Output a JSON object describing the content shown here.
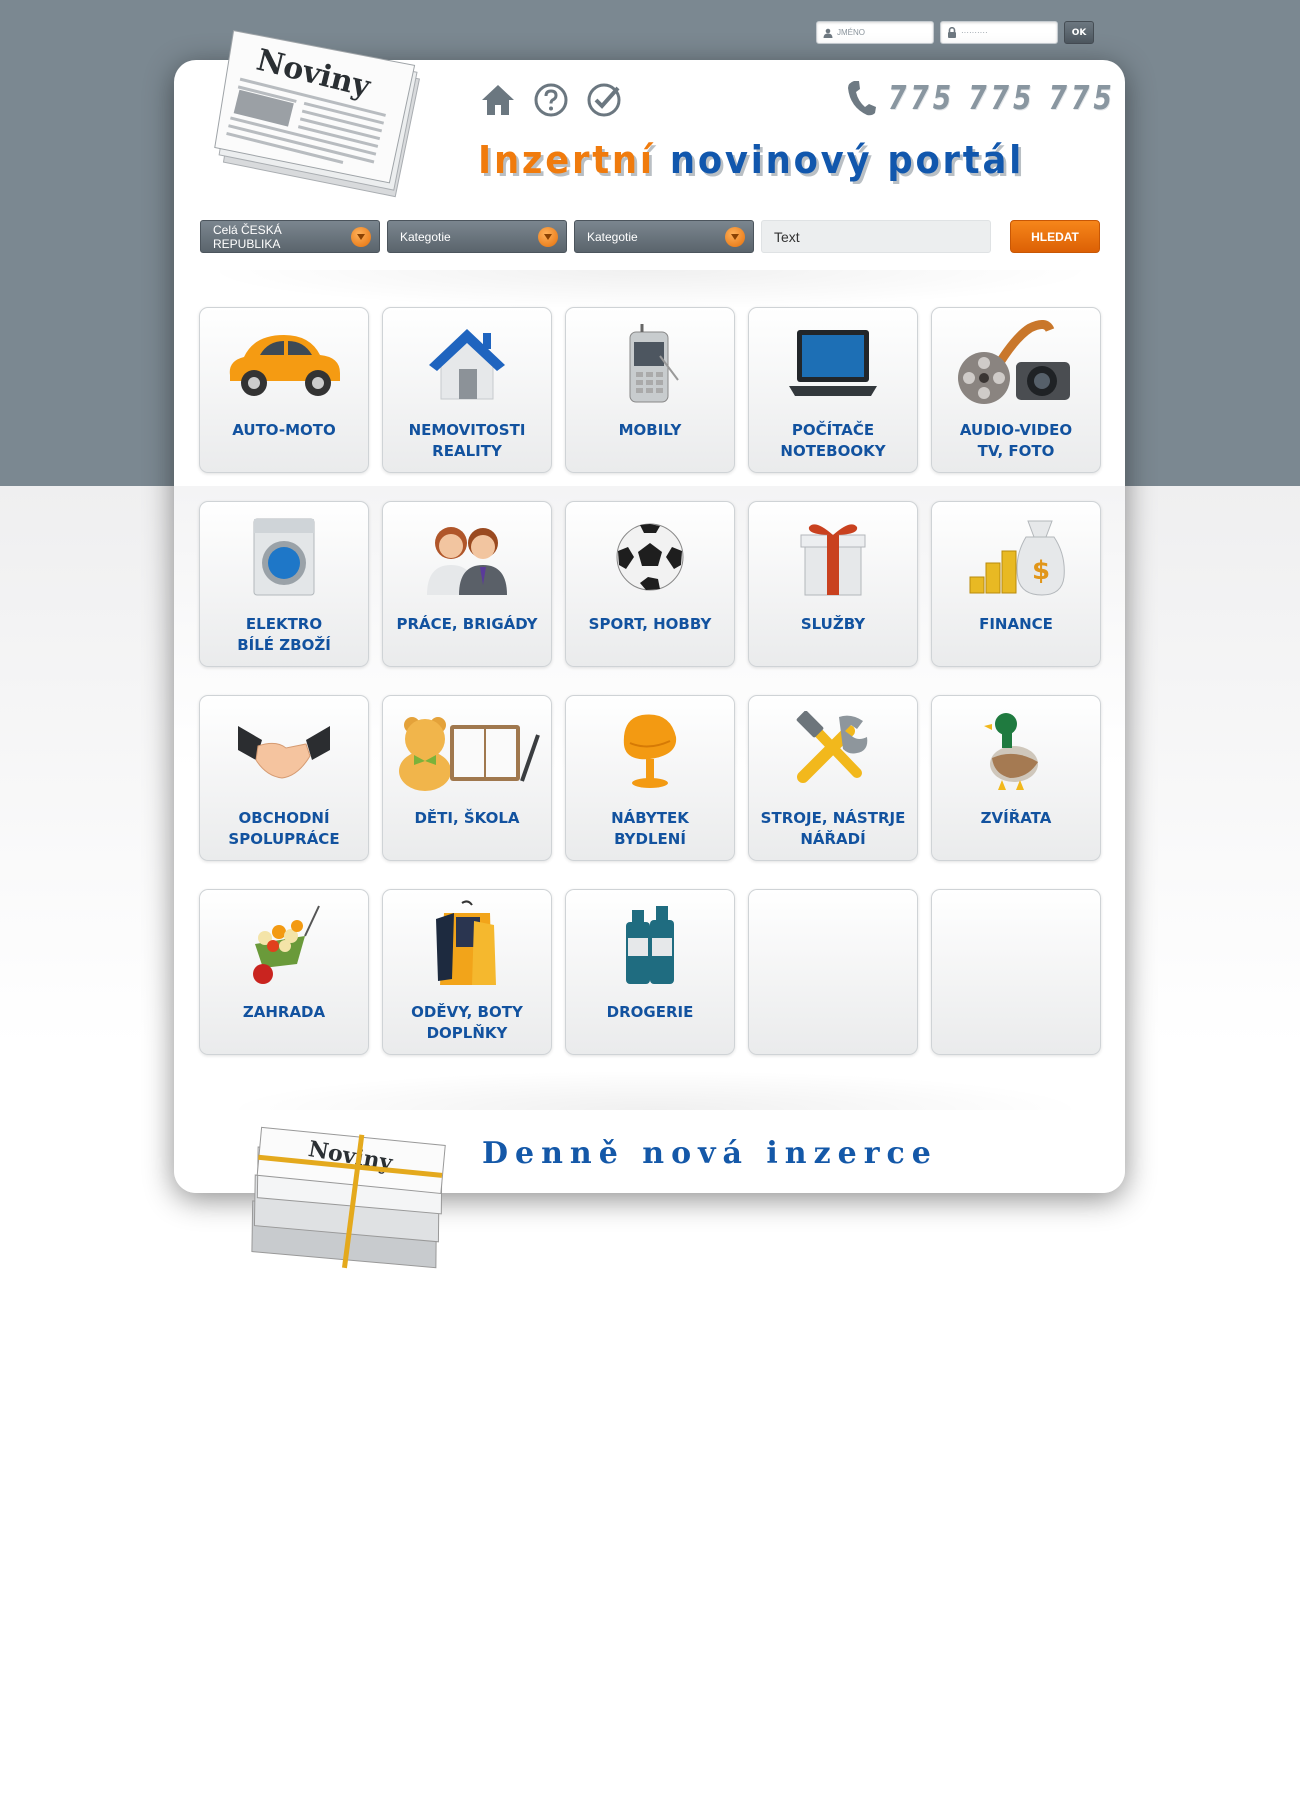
{
  "login": {
    "username_placeholder": "JMÉNO",
    "password_placeholder": "··········",
    "ok_label": "OK"
  },
  "header": {
    "logo_text": "Noviny",
    "phone": "775 775 775",
    "headline_part1": "Inzertní",
    "headline_part2": "novinový portál",
    "icons": [
      "home-icon",
      "help-icon",
      "check-icon"
    ]
  },
  "search": {
    "region": "Celá ČESKÁ REPUBLIKA",
    "category1": "Kategotie",
    "category2": "Kategotie",
    "text_placeholder": "Text",
    "button": "HLEDAT"
  },
  "categories": [
    {
      "label": "AUTO-MOTO",
      "icon": "car-icon"
    },
    {
      "label": "NEMOVITOSTI\nREALITY",
      "icon": "house-icon"
    },
    {
      "label": "MOBILY",
      "icon": "mobile-phone-icon"
    },
    {
      "label": "POČÍTAČE\nNOTEBOOKY",
      "icon": "laptop-icon"
    },
    {
      "label": "AUDIO-VIDEO\nTV, FOTO",
      "icon": "film-camera-icon"
    },
    {
      "label": "ELEKTRO\nBÍLÉ ZBOŽÍ",
      "icon": "washing-machine-icon"
    },
    {
      "label": "PRÁCE, BRIGÁDY",
      "icon": "people-icon"
    },
    {
      "label": "SPORT, HOBBY",
      "icon": "soccer-ball-icon"
    },
    {
      "label": "SLUŽBY",
      "icon": "gift-icon"
    },
    {
      "label": "FINANCE",
      "icon": "money-bag-icon"
    },
    {
      "label": "OBCHODNÍ\nSPOLUPRÁCE",
      "icon": "handshake-icon"
    },
    {
      "label": "DĚTI, ŠKOLA",
      "icon": "teddy-notebook-icon"
    },
    {
      "label": "NÁBYTEK\nBYDLENÍ",
      "icon": "chair-icon"
    },
    {
      "label": "STROJE, NÁSTRJE\nNÁŘADÍ",
      "icon": "tools-icon"
    },
    {
      "label": "ZVÍŘATA",
      "icon": "duck-icon"
    },
    {
      "label": "ZAHRADA",
      "icon": "wheelbarrow-icon"
    },
    {
      "label": "ODĚVY, BOTY\nDOPLŇKY",
      "icon": "clothes-icon"
    },
    {
      "label": "DROGERIE",
      "icon": "bottles-icon"
    },
    {
      "label": "",
      "icon": ""
    },
    {
      "label": "",
      "icon": ""
    }
  ],
  "footer": {
    "tagline": "Denně nová inzerce",
    "paper_text": "Noviny"
  },
  "colors": {
    "accent_orange": "#f07b0d",
    "brand_blue": "#1157ad",
    "header_gray": "#7b8891"
  }
}
